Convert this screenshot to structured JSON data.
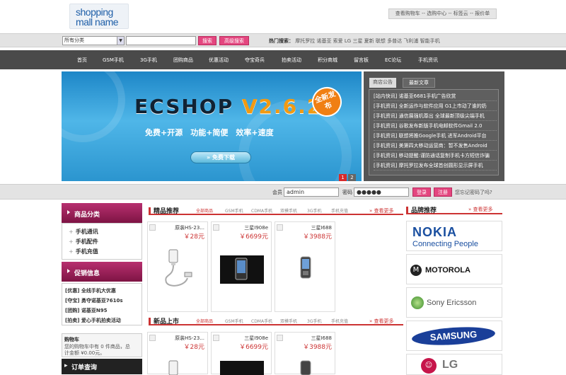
{
  "logo": {
    "line1": "shopping",
    "line2": "mall name"
  },
  "top_links": "查看购物车 -- 选购中心 -- 标签云 -- 报价单",
  "search": {
    "category_value": "所有分类",
    "search_label": "搜索",
    "advanced_label": "高级搜索",
    "hot_label": "热门搜索：",
    "hot_terms": "摩托罗拉 诺基亚 索爱 LG 三星 夏新 联想 多普达 飞利浦 智能手机"
  },
  "nav": [
    "首页",
    "GSM手机",
    "3G手机",
    "团购商品",
    "优惠活动",
    "夺宝奇兵",
    "拍卖活动",
    "积分商城",
    "留言板",
    "EC论坛",
    "手机资讯"
  ],
  "banner": {
    "brand": "ECSHOP",
    "version": "V2.6.2",
    "badge": "全新发布",
    "slogan": "免费+开源　功能+简便　效率+速度",
    "download": "免费下载",
    "pages": [
      "1",
      "2"
    ]
  },
  "news": {
    "tabs": [
      "商店公告",
      "最新文章"
    ],
    "items": [
      "[站内快讯] 诺基亚6681手机广告欣赏",
      "[手机资讯] 全新运作与软件应用 G1上市动了谁的奶",
      "[手机资讯] 通信展强机尊出 全球最新顶级尖端手机",
      "[手机资讯] 谷歌发布新版手机电邮软件Gmail 2.0",
      "[手机资讯] 联想将推Google手机 进军Android平台",
      "[手机资讯] 美第四大移动运营商：暂不发售Android",
      "[手机资讯] 移动提醒:谨防通话复制手机卡方短信诈骗",
      "[手机资讯] 摩托罗拉发布全球首创圆形显示屏手机"
    ]
  },
  "login": {
    "user_label": "会员",
    "user_value": "admin",
    "pass_label": "密码",
    "pass_value": "●●●●●",
    "login_btn": "登录",
    "register_btn": "注册",
    "forgot": "您忘记密码了吗?"
  },
  "left": {
    "category_title": "商品分类",
    "categories": [
      "手机通讯",
      "手机配件",
      "手机充值"
    ],
    "promo_title": "促销信息",
    "promos": [
      "[优惠] 全线手机大优惠",
      "[夺宝] 勇夺诺基亚7610s",
      "[团购] 诺基亚N95",
      "[拍卖] 爱心手机拍卖活动"
    ],
    "cart_title": "购物车",
    "cart_text1": "您的购物车中有 0 件商品，总",
    "cart_text2": "计金额 ¥0.00元。",
    "order_title": "订单查询"
  },
  "featured": {
    "title": "精品推荐",
    "tabs": [
      "全部商品",
      "GSM手机",
      "CDMA手机",
      "双模手机",
      "3G手机",
      "手机充值"
    ],
    "more": "查看更多"
  },
  "newarrivals": {
    "title": "新品上市",
    "tabs": [
      "全部商品",
      "GSM手机",
      "CDMA手机",
      "双模手机",
      "3G手机",
      "手机充值"
    ],
    "more": "查看更多"
  },
  "products": [
    {
      "name": "原装HS-23...",
      "price": "￥28元"
    },
    {
      "name": "三星I908e",
      "price": "￥6699元"
    },
    {
      "name": "三星I688",
      "price": "￥3988元"
    }
  ],
  "brands": {
    "title": "品牌推荐",
    "more": "查看更多",
    "items": [
      "NOKIA",
      "Connecting People",
      "MOTOROLA",
      "Sony Ericsson",
      "SAMSUNG",
      "LG"
    ]
  },
  "colors": {
    "accent": "#e4467f",
    "nav_bg": "#4a4a4a",
    "price_red": "#cc3333",
    "category_header": "#9c2258"
  }
}
